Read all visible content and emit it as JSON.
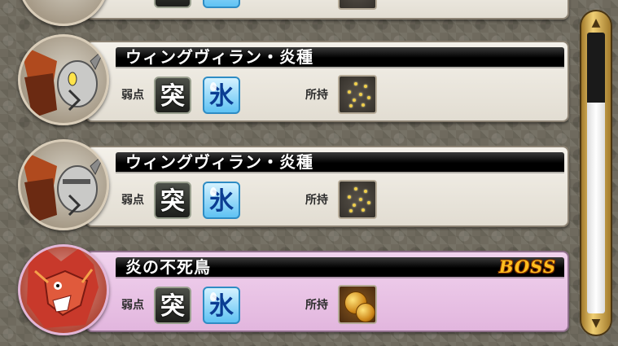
{
  "monsters": [
    {
      "name": "ウィングヴィラン・炎種",
      "weak_label": "弱点",
      "weak": [
        "突",
        "氷"
      ],
      "own_label": "所持",
      "item": "seeds"
    },
    {
      "name": "ウィングヴィラン・炎種",
      "weak_label": "弱点",
      "weak": [
        "突",
        "氷"
      ],
      "own_label": "所持",
      "item": "seeds"
    },
    {
      "name": "炎の不死鳥",
      "boss_label": "BOSS",
      "weak_label": "弱点",
      "weak": [
        "突",
        "氷"
      ],
      "own_label": "所持",
      "item": "coins"
    }
  ],
  "scrollbar": {
    "position_fraction": 0.78,
    "visible_fraction": 0.75
  },
  "colors": {
    "card": "#e9e5dc",
    "boss_card": "#e8c1e4",
    "boss_label": "#ffbe1e",
    "ice_element": "#5fc2f3",
    "thrust_element": "#2a2b27",
    "scroll_frame": "#d8b558"
  },
  "icons": {
    "thrust": "thrust-element-icon",
    "ice": "ice-element-icon",
    "seeds": "seed-item-icon",
    "coins": "gold-coin-item-icon"
  }
}
